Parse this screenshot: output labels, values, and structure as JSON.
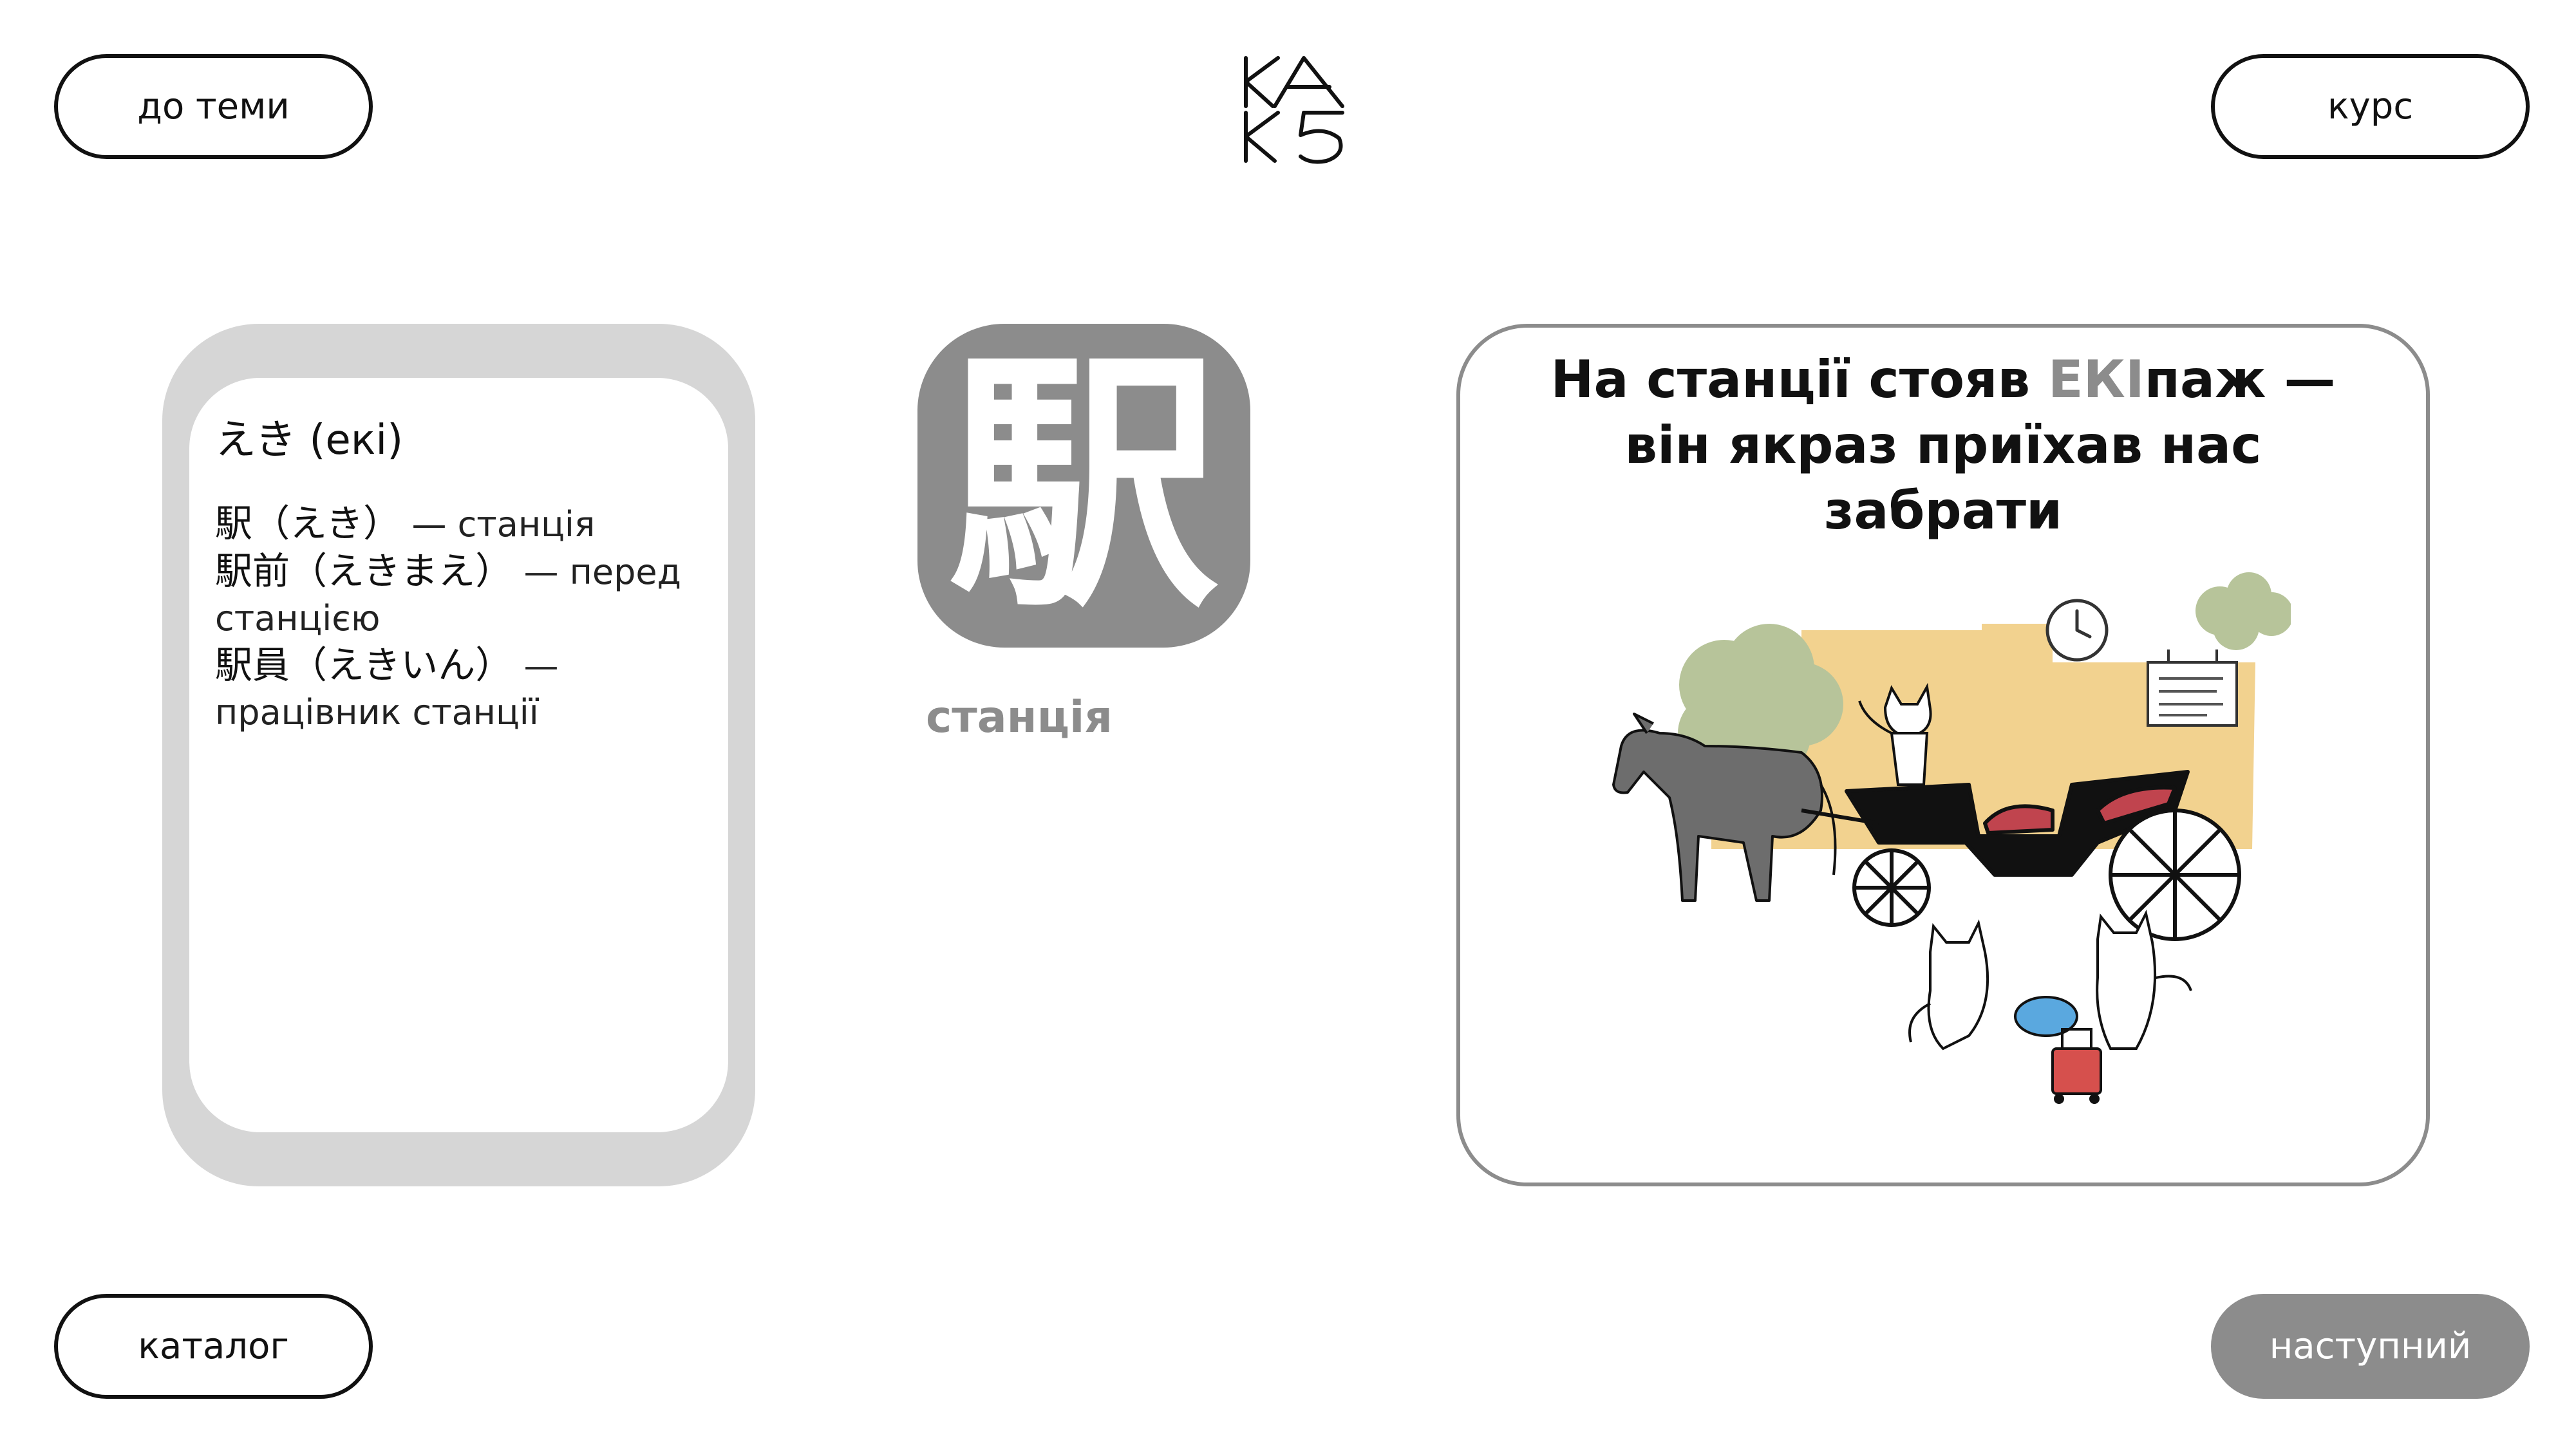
{
  "nav": {
    "back_label": "до теми",
    "course_label": "курс",
    "catalog_label": "каталог",
    "next_label": "наступний"
  },
  "colors": {
    "accent_gray": "#8c8c8c",
    "card_border_gray": "#d6d6d6",
    "text_dark": "#111111",
    "house_yellow": "#f2d28f",
    "bush_green": "#b7c49a",
    "seat_red": "#c0444e",
    "bowl_blue": "#5aa8df",
    "bag_red": "#d6504d"
  },
  "vocab": {
    "reading": "えき (екі)",
    "entries": [
      {
        "jp": "駅（えき）",
        "meaning": "— станція"
      },
      {
        "jp": "駅前（えきまえ）",
        "meaning": "— перед станцією"
      },
      {
        "jp": "駅員（えきいん）",
        "meaning": "— працівник станції"
      }
    ]
  },
  "kanji": {
    "character": "駅",
    "meaning": "станція"
  },
  "mnemonic": {
    "before": "На станції стояв ",
    "highlight": "ЕКІ",
    "after": "паж — він якраз приїхав нас забрати"
  },
  "icons": {
    "logo": "kanji-app-logo-icon",
    "illustration": "horse-carriage-station-cats-illustration"
  }
}
